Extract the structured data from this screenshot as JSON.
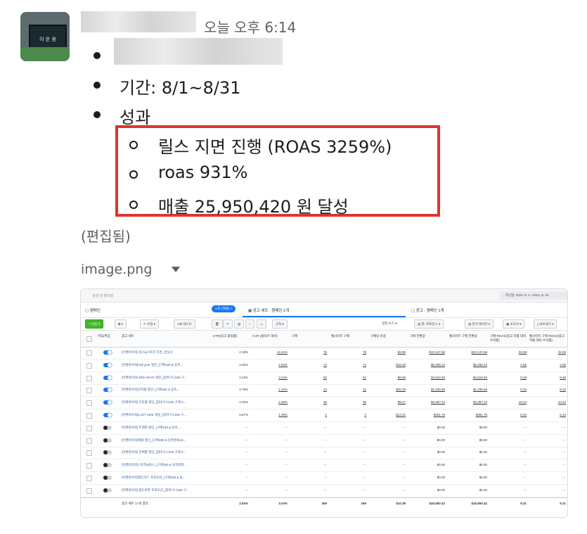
{
  "message": {
    "time": "오늘 오후 6:14",
    "bullets": [
      {
        "text": ""
      },
      {
        "text": "기간: 8/1~8/31"
      },
      {
        "text": "성과"
      }
    ],
    "sub_bullets": [
      "릴스 지면 진행 (ROAS 3259%)",
      "roas 931%",
      "매출 25,950,420 원 달성"
    ],
    "edited_label": "(편집됨)",
    "attachment_name": "image.png"
  },
  "attachment": {
    "search_placeholder": "검색 및 필터링",
    "date_range": "지난달: 2024. 8. 1.~2024. 8. 31.",
    "tabs": {
      "campaign": "캠페인",
      "selected_pill": "1개 선택됨",
      "adset": "광고 세트 - 캠페인 1개",
      "ad": "광고 - 캠페인 1개"
    },
    "toolbar": {
      "create": "+ 만들기",
      "edit": "수정",
      "ab_test": "A/B 테스트",
      "rules": "규칙",
      "settings_toggle": "설정 보기",
      "columns": "열: 퍼포먼스",
      "breakdown": "분석 데이터",
      "reports": "보고서",
      "export": "내보내기"
    },
    "headers": [
      "꺼짐/켜짐",
      "광고 세트",
      "CTR(링크 클릭률)",
      "CVR (클릭수 대비)",
      "구매",
      "웹사이트 구매",
      "구매당 비용",
      "구매 전환값",
      "웹사이트 구매 전환값",
      "구매 ROAS(광고 지출 대비 수익률)",
      "웹사이트 구매 ROAS(광고 지출 대비 수익률)"
    ],
    "rows": [
      {
        "on": true,
        "name": "[어맨바이의] 릴스&스토리 지면_관심사",
        "ctr": "2.18%",
        "cvr": "14.44%",
        "p": "78",
        "wp": "78",
        "cpp": "$3.99",
        "val": "$10,137.65",
        "wval": "$10,137.65",
        "roas": "32.59",
        "wroas": "32.59"
      },
      {
        "on": true,
        "name": "[어맨바이의]mid-year 할인_[구매180 & 동특...",
        "ctr": "3.36%",
        "cvr": "1.84%",
        "p": "74",
        "wp": "74",
        "cpp": "$18.28",
        "val": "$6,288.23",
        "wval": "$6,288.23",
        "roas": "4.65",
        "wroas": "4.65"
      },
      {
        "on": true,
        "name": "[어맨바이의] MID-YEAR 세일_[장바구니180 구...",
        "ctr": "2.23%",
        "cvr": "3.24%",
        "p": "62",
        "wp": "62",
        "cpp": "$8.09",
        "val": "$4,518.93",
        "wval": "$4,518.93",
        "roas": "8.48",
        "wroas": "8.48"
      },
      {
        "on": true,
        "name": "[어맨바이의]신작품 할인_[구매180 & 동특...",
        "ctr": "4.79%",
        "cvr": "1.10%",
        "p": "12",
        "wp": "12",
        "cpp": "$16.29",
        "val": "$1,236.58",
        "wval": "$1,236.58",
        "roas": "6.32",
        "wroas": "6.32"
      },
      {
        "on": true,
        "name": "[어맨바이의] 신작품 할인_[장바구니180 구매 3...",
        "ctr": "4.45%",
        "cvr": "2.30%",
        "p": "35",
        "wp": "35",
        "cpp": "$9.27",
        "val": "$3,387.24",
        "wval": "$3,387.24",
        "roas": "10.44",
        "wroas": "10.44"
      },
      {
        "on": true,
        "name": "[어맨바이의]LAST SIZE 세일_[장바구니180 구...",
        "ctr": "5.67%",
        "cvr": "1.35%",
        "p": "2",
        "wp": "2",
        "cpp": "$13.31",
        "val": "$381.75",
        "wval": "$381.75",
        "roas": "6.23",
        "wroas": "6.23"
      },
      {
        "on": false,
        "name": "[어맨바이의] 트래픽 할인_[구매180 & 동특...",
        "ctr": "—",
        "cvr": "—",
        "p": "—",
        "wp": "—",
        "cpp": "—",
        "val": "$0.00",
        "wval": "$0.00",
        "roas": "—",
        "wroas": "—"
      },
      {
        "on": false,
        "name": "[어맨바이의]재품 할인_[구매180 & 동특완료18...",
        "ctr": "—",
        "cvr": "—",
        "p": "—",
        "wp": "—",
        "cpp": "—",
        "val": "$0.00",
        "wval": "$0.00",
        "roas": "—",
        "wroas": "—"
      },
      {
        "on": false,
        "name": "[어맨바이의] 전체품 할인_[장바구니180 구매 3...",
        "ctr": "—",
        "cvr": "—",
        "p": "—",
        "wp": "—",
        "cpp": "—",
        "val": "$0.00",
        "wval": "$0.00",
        "roas": "—",
        "wroas": "—"
      },
      {
        "on": false,
        "name": "[어맨바이의]스토리&릴스_[구매180 & 동특완료...",
        "ctr": "—",
        "cvr": "—",
        "p": "—",
        "wp": "—",
        "cpp": "—",
        "val": "$0.00",
        "wval": "$0.00",
        "roas": "—",
        "wroas": "—"
      },
      {
        "on": false,
        "name": "[어맨바이의]할인코드 프로모션_[구매180 & 동...",
        "ctr": "—",
        "cvr": "—",
        "p": "—",
        "wp": "—",
        "cpp": "—",
        "val": "$0.00",
        "wval": "$0.00",
        "roas": "—",
        "wroas": "—"
      },
      {
        "on": false,
        "name": "[어맨바이의] 할인쿠폰 프로모션_[장바구니180 구...",
        "ctr": "—",
        "cvr": "—",
        "p": "—",
        "wp": "—",
        "cpp": "—",
        "val": "$0.00",
        "wval": "$0.00",
        "roas": "—",
        "wroas": "—"
      }
    ],
    "total": {
      "label": "광고 세트 17개 결과",
      "ctr": "2.82%",
      "cvr": "3.03%",
      "p": "269",
      "wp": "269",
      "cpp": "$10.38",
      "val": "$25,950.42",
      "wval": "$25,950.42",
      "roas": "9.31",
      "wroas": "9.31"
    }
  }
}
